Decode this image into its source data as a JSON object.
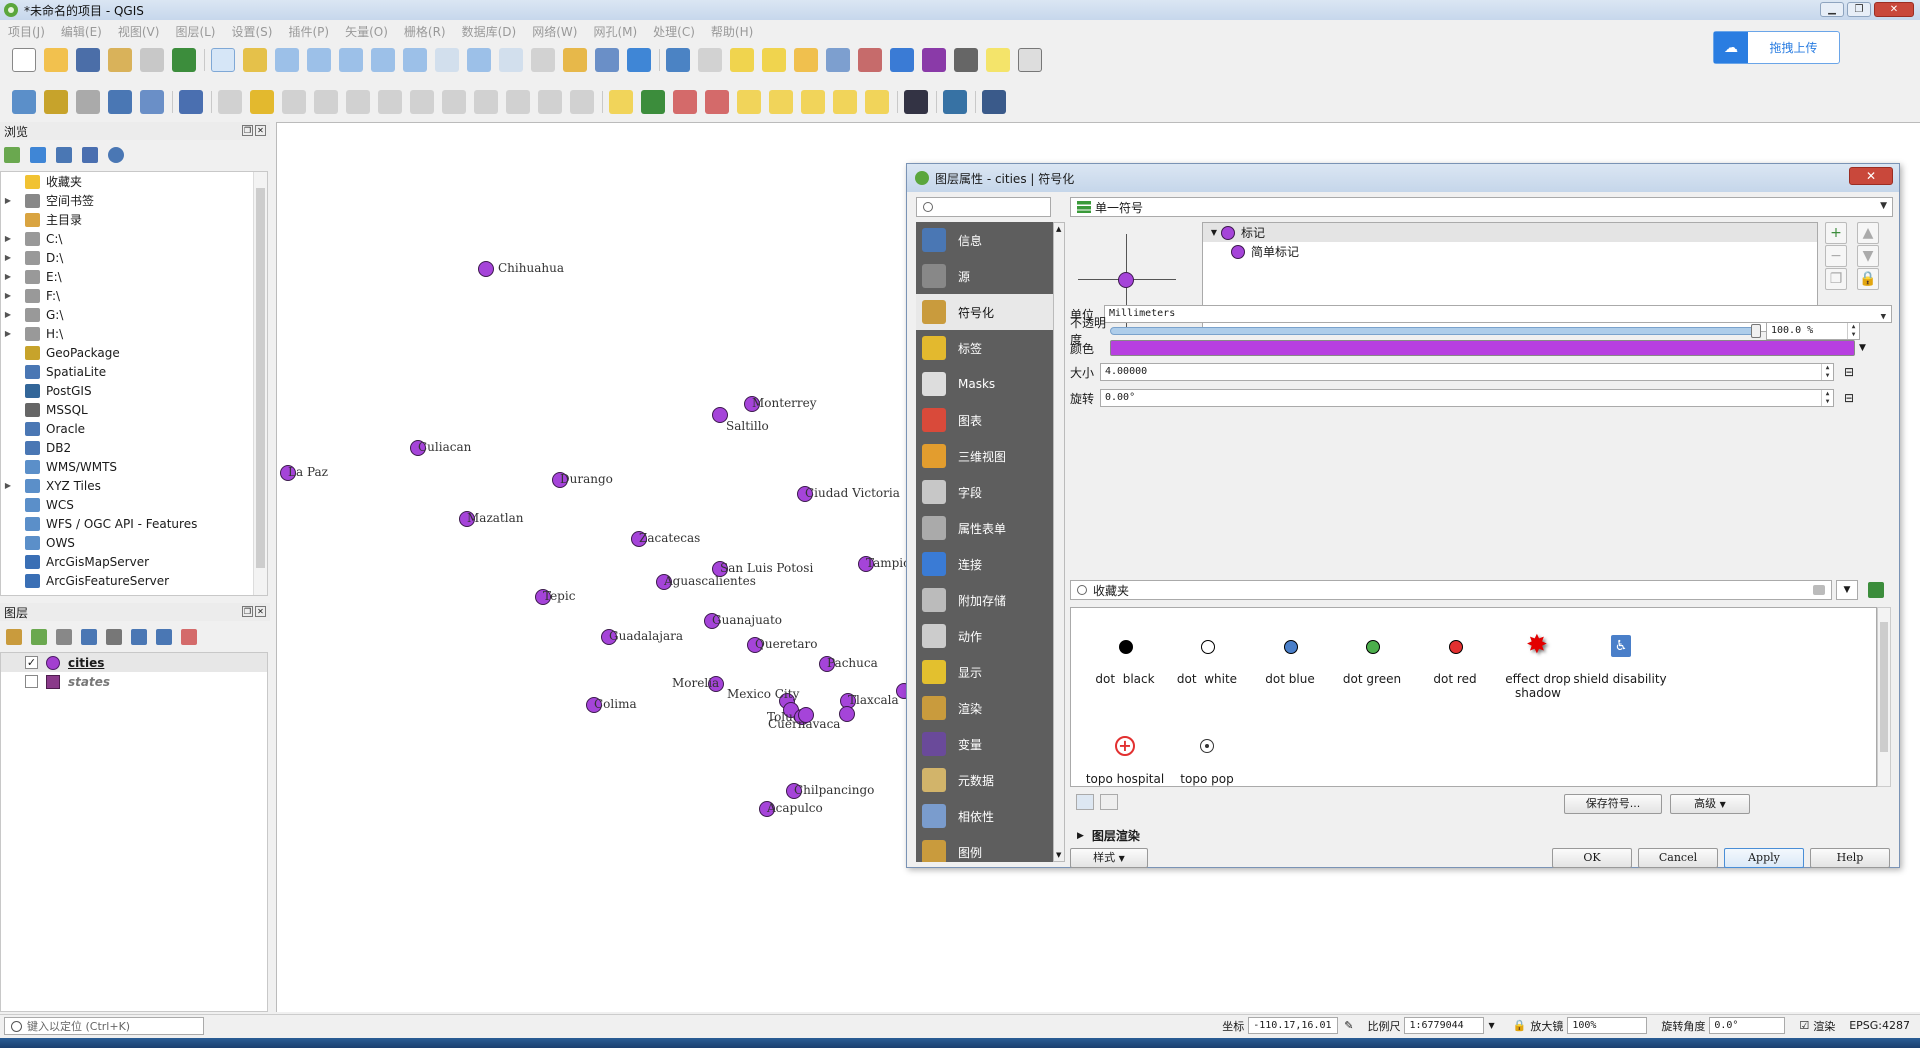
{
  "window": {
    "title": "*未命名的项目 - QGIS"
  },
  "menu": [
    "项目(J)",
    "编辑(E)",
    "视图(V)",
    "图层(L)",
    "设置(S)",
    "插件(P)",
    "矢量(O)",
    "栅格(R)",
    "数据库(D)",
    "网络(W)",
    "网孔(M)",
    "处理(C)",
    "帮助(H)"
  ],
  "cloud": {
    "label": "拖拽上传"
  },
  "browser": {
    "title": "浏览",
    "items": [
      {
        "label": "收藏夹",
        "icon": "star-icon",
        "color": "#f1c232"
      },
      {
        "label": "空间书签",
        "icon": "bookmark-icon",
        "color": "#888888"
      },
      {
        "label": "主目录",
        "icon": "home-folder-icon",
        "color": "#d9a441"
      },
      {
        "label": "C:\\",
        "icon": "drive-icon",
        "color": "#999999"
      },
      {
        "label": "D:\\",
        "icon": "drive-icon",
        "color": "#999999"
      },
      {
        "label": "E:\\",
        "icon": "drive-icon",
        "color": "#999999"
      },
      {
        "label": "F:\\",
        "icon": "drive-icon",
        "color": "#999999"
      },
      {
        "label": "G:\\",
        "icon": "drive-icon",
        "color": "#999999"
      },
      {
        "label": "H:\\",
        "icon": "drive-icon",
        "color": "#999999"
      },
      {
        "label": "GeoPackage",
        "icon": "geopackage-icon",
        "color": "#c7a32b"
      },
      {
        "label": "SpatiaLite",
        "icon": "spatialite-icon",
        "color": "#4a77b4"
      },
      {
        "label": "PostGIS",
        "icon": "postgis-icon",
        "color": "#336699"
      },
      {
        "label": "MSSQL",
        "icon": "mssql-icon",
        "color": "#666666"
      },
      {
        "label": "Oracle",
        "icon": "oracle-icon",
        "color": "#4a77b4"
      },
      {
        "label": "DB2",
        "icon": "db2-icon",
        "color": "#4a77b4"
      },
      {
        "label": "WMS/WMTS",
        "icon": "globe-icon",
        "color": "#5b8fc9"
      },
      {
        "label": "XYZ Tiles",
        "icon": "tiles-icon",
        "color": "#5b8fc9"
      },
      {
        "label": "WCS",
        "icon": "globe-icon",
        "color": "#5b8fc9"
      },
      {
        "label": "WFS / OGC API - Features",
        "icon": "globe-icon",
        "color": "#5b8fc9"
      },
      {
        "label": "OWS",
        "icon": "globe-icon",
        "color": "#5b8fc9"
      },
      {
        "label": "ArcGisMapServer",
        "icon": "arcgis-icon",
        "color": "#3a6fb5"
      },
      {
        "label": "ArcGisFeatureServer",
        "icon": "arcgis-icon",
        "color": "#3a6fb5"
      }
    ]
  },
  "layers": {
    "title": "图层",
    "items": [
      {
        "name": "cities",
        "checked": "✓"
      },
      {
        "name": "states",
        "checked": ""
      }
    ]
  },
  "map": {
    "cities": [
      {
        "name": "Chihuahua"
      },
      {
        "name": "Monterrey"
      },
      {
        "name": "Saltillo"
      },
      {
        "name": "Culiacan"
      },
      {
        "name": "La Paz"
      },
      {
        "name": "Durango"
      },
      {
        "name": "Ciudad Victoria"
      },
      {
        "name": "Mazatlan"
      },
      {
        "name": "Zacatecas"
      },
      {
        "name": "San Luis Potosi"
      },
      {
        "name": "Tampico"
      },
      {
        "name": "Aguascalientes"
      },
      {
        "name": "Tepic"
      },
      {
        "name": "Guanajuato"
      },
      {
        "name": "Guadalajara"
      },
      {
        "name": "Queretaro"
      },
      {
        "name": "Pachuca"
      },
      {
        "name": "Morelia"
      },
      {
        "name": "Mexico City"
      },
      {
        "name": "Tlaxcala"
      },
      {
        "name": "Toluca"
      },
      {
        "name": "Colima"
      },
      {
        "name": "Cuernavaca"
      },
      {
        "name": "Chilpancingo"
      },
      {
        "name": "Acapulco"
      },
      {
        "name": ""
      },
      {
        "name": ""
      },
      {
        "name": ""
      }
    ]
  },
  "status": {
    "locator_placeholder": "键入以定位 (Ctrl+K)",
    "coord_label": "坐标",
    "coord_value": "-110.17,16.01",
    "scale_label": "比例尺",
    "scale_value": "1:6779044",
    "magnifier_label": "放大镜",
    "magnifier_value": "100%",
    "rotation_label": "旋转角度",
    "rotation_value": "0.0°",
    "render_label": "渲染",
    "crs_value": "EPSG:4287"
  },
  "dialog": {
    "title": "图层属性 - cities | 符号化",
    "close_label": "✕",
    "sidebar": [
      {
        "label": "信息",
        "icon": "info-icon",
        "color": "#4a77b4"
      },
      {
        "label": "源",
        "icon": "source-icon",
        "color": "#888888"
      },
      {
        "label": "符号化",
        "icon": "symbology-icon",
        "color": "#c99b3d"
      },
      {
        "label": "标签",
        "icon": "labels-icon",
        "color": "#e3b92e"
      },
      {
        "label": "Masks",
        "icon": "masks-icon",
        "color": "#dddddd"
      },
      {
        "label": "图表",
        "icon": "diagrams-icon",
        "color": "#d94a3a"
      },
      {
        "label": "三维视图",
        "icon": "3d-view-icon",
        "color": "#e39d2e"
      },
      {
        "label": "字段",
        "icon": "fields-icon",
        "color": "#c7c7c7"
      },
      {
        "label": "属性表单",
        "icon": "attribute-form-icon",
        "color": "#aaaaaa"
      },
      {
        "label": "连接",
        "icon": "joins-icon",
        "color": "#3a7bd5"
      },
      {
        "label": "附加存储",
        "icon": "auxiliary-storage-icon",
        "color": "#bbbbbb"
      },
      {
        "label": "动作",
        "icon": "actions-icon",
        "color": "#cccccc"
      },
      {
        "label": "显示",
        "icon": "display-icon",
        "color": "#e3c02e"
      },
      {
        "label": "渲染",
        "icon": "rendering-icon",
        "color": "#c99b3d"
      },
      {
        "label": "变量",
        "icon": "variables-icon",
        "color": "#6a4a9a"
      },
      {
        "label": "元数据",
        "icon": "metadata-icon",
        "color": "#d2b46a"
      },
      {
        "label": "相依性",
        "icon": "dependencies-icon",
        "color": "#7a9ccd"
      },
      {
        "label": "图例",
        "icon": "legend-icon",
        "color": "#c99b3d"
      }
    ],
    "renderer": "单一符号",
    "symbol_tree": [
      "标记",
      "简单标记"
    ],
    "unit_label": "单位",
    "unit_value": "Millimeters",
    "opacity_label": "不透明度",
    "opacity_value": "100.0 %",
    "opacity_fraction": 1.0,
    "color_label": "颜色",
    "color_value": "#b73fe0",
    "size_label": "大小",
    "size_value": "4.00000",
    "rotation_label": "旋转",
    "rotation_value": "0.00°",
    "library_search": "收藏夹",
    "symbols": [
      {
        "label": "dot  black"
      },
      {
        "label": "dot  white"
      },
      {
        "label": "dot blue"
      },
      {
        "label": "dot green"
      },
      {
        "label": "dot red"
      },
      {
        "label": "effect drop shadow"
      },
      {
        "label": "shield disability"
      },
      {
        "label": "topo hospital"
      },
      {
        "label": "topo pop"
      }
    ],
    "save_symbol_label": "保存符号...",
    "advanced_label": "高级",
    "layer_rendering_label": "图层渲染",
    "style_label": "样式",
    "ok_label": "OK",
    "cancel_label": "Cancel",
    "apply_label": "Apply",
    "help_label": "Help"
  }
}
